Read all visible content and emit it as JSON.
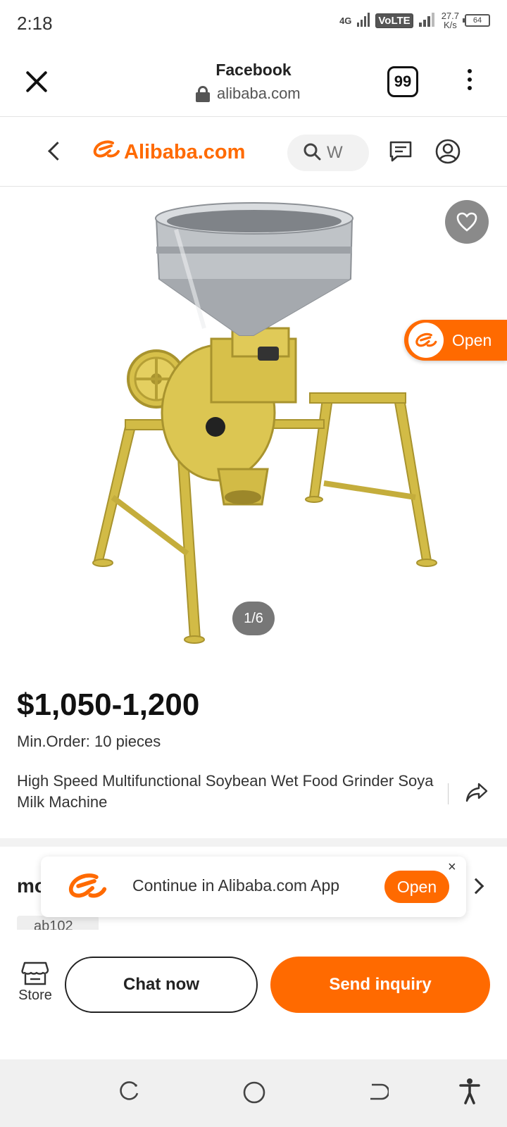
{
  "status_bar": {
    "time": "2:18",
    "network": "4G",
    "volte": "VoLTE",
    "speed_value": "27.7",
    "speed_unit": "K/s",
    "battery": "64"
  },
  "browser": {
    "title": "Facebook",
    "url": "alibaba.com",
    "tab_count": "99"
  },
  "site_header": {
    "logo_text": "Alibaba.com",
    "search_placeholder": "W"
  },
  "product": {
    "image_counter": "1/6",
    "open_label": "Open",
    "price": "$1,050-1,200",
    "min_order": "Min.Order: 10 pieces",
    "title": "High Speed Multifunctional Soybean Wet Food Grinder Soya Milk Machine"
  },
  "section": {
    "partial_heading": "mo",
    "partial_tag": "ab102"
  },
  "app_banner": {
    "text": "Continue in Alibaba.com App",
    "open_label": "Open",
    "close_symbol": "×"
  },
  "actions": {
    "store_label": "Store",
    "chat_label": "Chat now",
    "inquiry_label": "Send inquiry"
  },
  "colors": {
    "brand": "#ff6a00",
    "machine": "#d8c24a"
  }
}
